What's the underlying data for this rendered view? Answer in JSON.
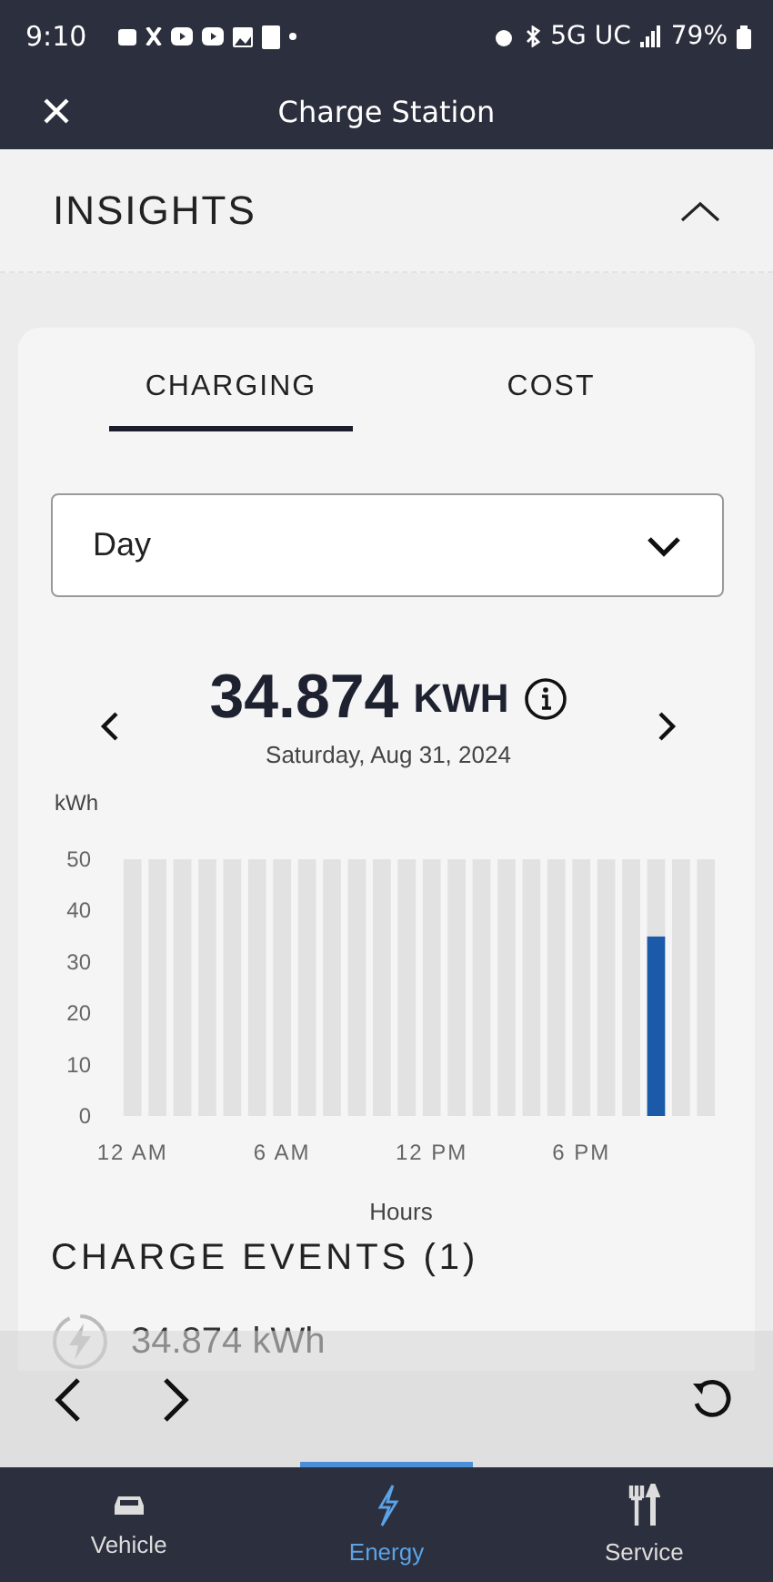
{
  "status_bar": {
    "time": "9:10",
    "network": "5G UC",
    "battery": "79%"
  },
  "header": {
    "title": "Charge Station"
  },
  "insights": {
    "title": "INSIGHTS",
    "expanded": true
  },
  "tabs": [
    {
      "label": "CHARGING",
      "selected": true
    },
    {
      "label": "COST",
      "selected": false
    }
  ],
  "period_select": {
    "value": "Day"
  },
  "total": {
    "value": "34.874",
    "unit": "KWH",
    "date": "Saturday, Aug 31, 2024"
  },
  "chart": {
    "chart_data": {
      "type": "bar",
      "ylabel": "kWh",
      "xlabel": "Hours",
      "categories": [
        "12 AM",
        null,
        null,
        null,
        null,
        null,
        "6 AM",
        null,
        null,
        null,
        null,
        null,
        "12 PM",
        null,
        null,
        null,
        null,
        null,
        "6 PM",
        null,
        null,
        null,
        null,
        null
      ],
      "stacked": true,
      "series": [
        {
          "color": "#1a5aa8",
          "values": [
            0,
            0,
            0,
            0,
            0,
            0,
            0,
            0,
            0,
            0,
            0,
            0,
            0,
            0,
            0,
            0,
            0,
            0,
            0,
            0,
            0,
            35,
            0,
            0
          ]
        },
        {
          "color": "#e2e2e2",
          "values": [
            50,
            50,
            50,
            50,
            50,
            50,
            50,
            50,
            50,
            50,
            50,
            50,
            50,
            50,
            50,
            50,
            50,
            50,
            50,
            50,
            50,
            15,
            50,
            50
          ]
        }
      ],
      "ylim": [
        0,
        50
      ],
      "yticks": [
        0,
        10,
        20,
        30,
        40,
        50
      ]
    }
  },
  "charge_events": {
    "title": "CHARGE EVENTS (1)",
    "events": [
      {
        "energy": "34.874 kWh"
      }
    ]
  },
  "bottom_nav": [
    {
      "label": "Vehicle",
      "kind": "vehicle",
      "selected": false
    },
    {
      "label": "Energy",
      "kind": "energy",
      "selected": true
    },
    {
      "label": "Service",
      "kind": "service",
      "selected": false
    }
  ]
}
